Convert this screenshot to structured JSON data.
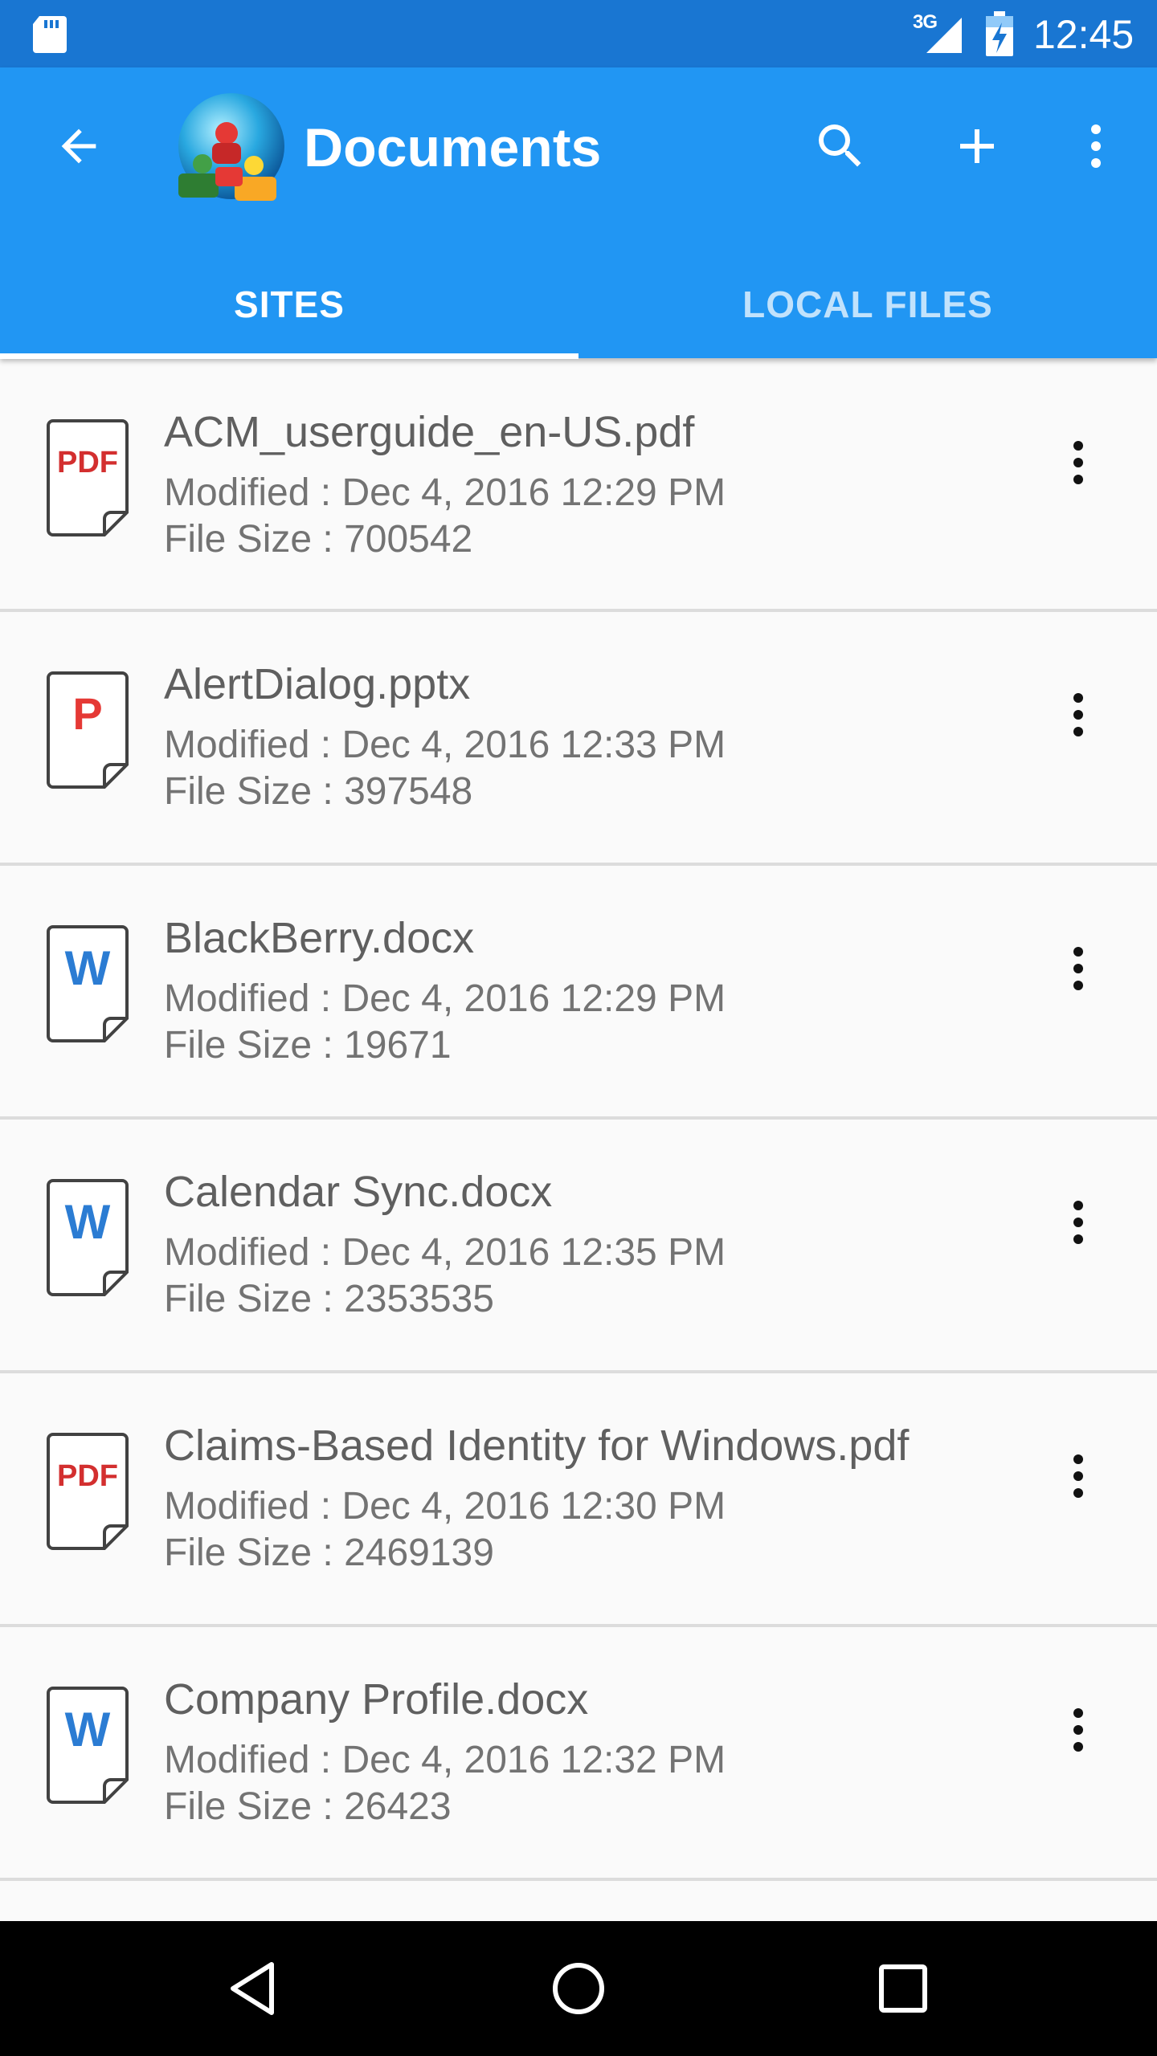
{
  "status_bar": {
    "time": "12:45",
    "network": "3G",
    "icons": [
      "sd-card-icon",
      "signal-icon",
      "battery-charging-icon"
    ]
  },
  "app_bar": {
    "title": "Documents",
    "back_icon": "arrow-back-icon",
    "logo_icon": "app-logo-icon",
    "actions": [
      "search-icon",
      "add-icon",
      "more-vert-icon"
    ]
  },
  "tabs": [
    {
      "label": "SITES",
      "selected": true
    },
    {
      "label": "LOCAL FILES",
      "selected": false
    }
  ],
  "files": [
    {
      "type": "pdf",
      "name": "ACM_userguide_en-US.pdf",
      "modified": "Modified : Dec 4, 2016 12:29 PM",
      "size": "File Size : 700542"
    },
    {
      "type": "pptx",
      "name": "AlertDialog.pptx",
      "modified": "Modified : Dec 4, 2016 12:33 PM",
      "size": "File Size : 397548"
    },
    {
      "type": "docx",
      "name": "BlackBerry.docx",
      "modified": "Modified : Dec 4, 2016 12:29 PM",
      "size": "File Size : 19671"
    },
    {
      "type": "docx",
      "name": "Calendar Sync.docx",
      "modified": "Modified : Dec 4, 2016 12:35 PM",
      "size": "File Size : 2353535"
    },
    {
      "type": "pdf",
      "name": "Claims-Based Identity for Windows.pdf",
      "modified": "Modified : Dec 4, 2016 12:30 PM",
      "size": "File Size : 2469139"
    },
    {
      "type": "docx",
      "name": "Company Profile.docx",
      "modified": "Modified : Dec 4, 2016 12:32 PM",
      "size": "File Size : 26423"
    }
  ],
  "file_icon_labels": {
    "pdf": "PDF",
    "pptx": "P",
    "docx": "W"
  },
  "colors": {
    "status_bar": "#1976d2",
    "app_bar": "#2196f3",
    "pdf_red": "#d32f2f",
    "ppt_red": "#e53935",
    "word_blue": "#2b7cd3",
    "text_primary": "#5f5f5f",
    "text_secondary": "#737373",
    "divider": "#dcdcdc"
  },
  "nav_bar": {
    "icons": [
      "nav-back-icon",
      "nav-home-icon",
      "nav-recents-icon"
    ]
  }
}
